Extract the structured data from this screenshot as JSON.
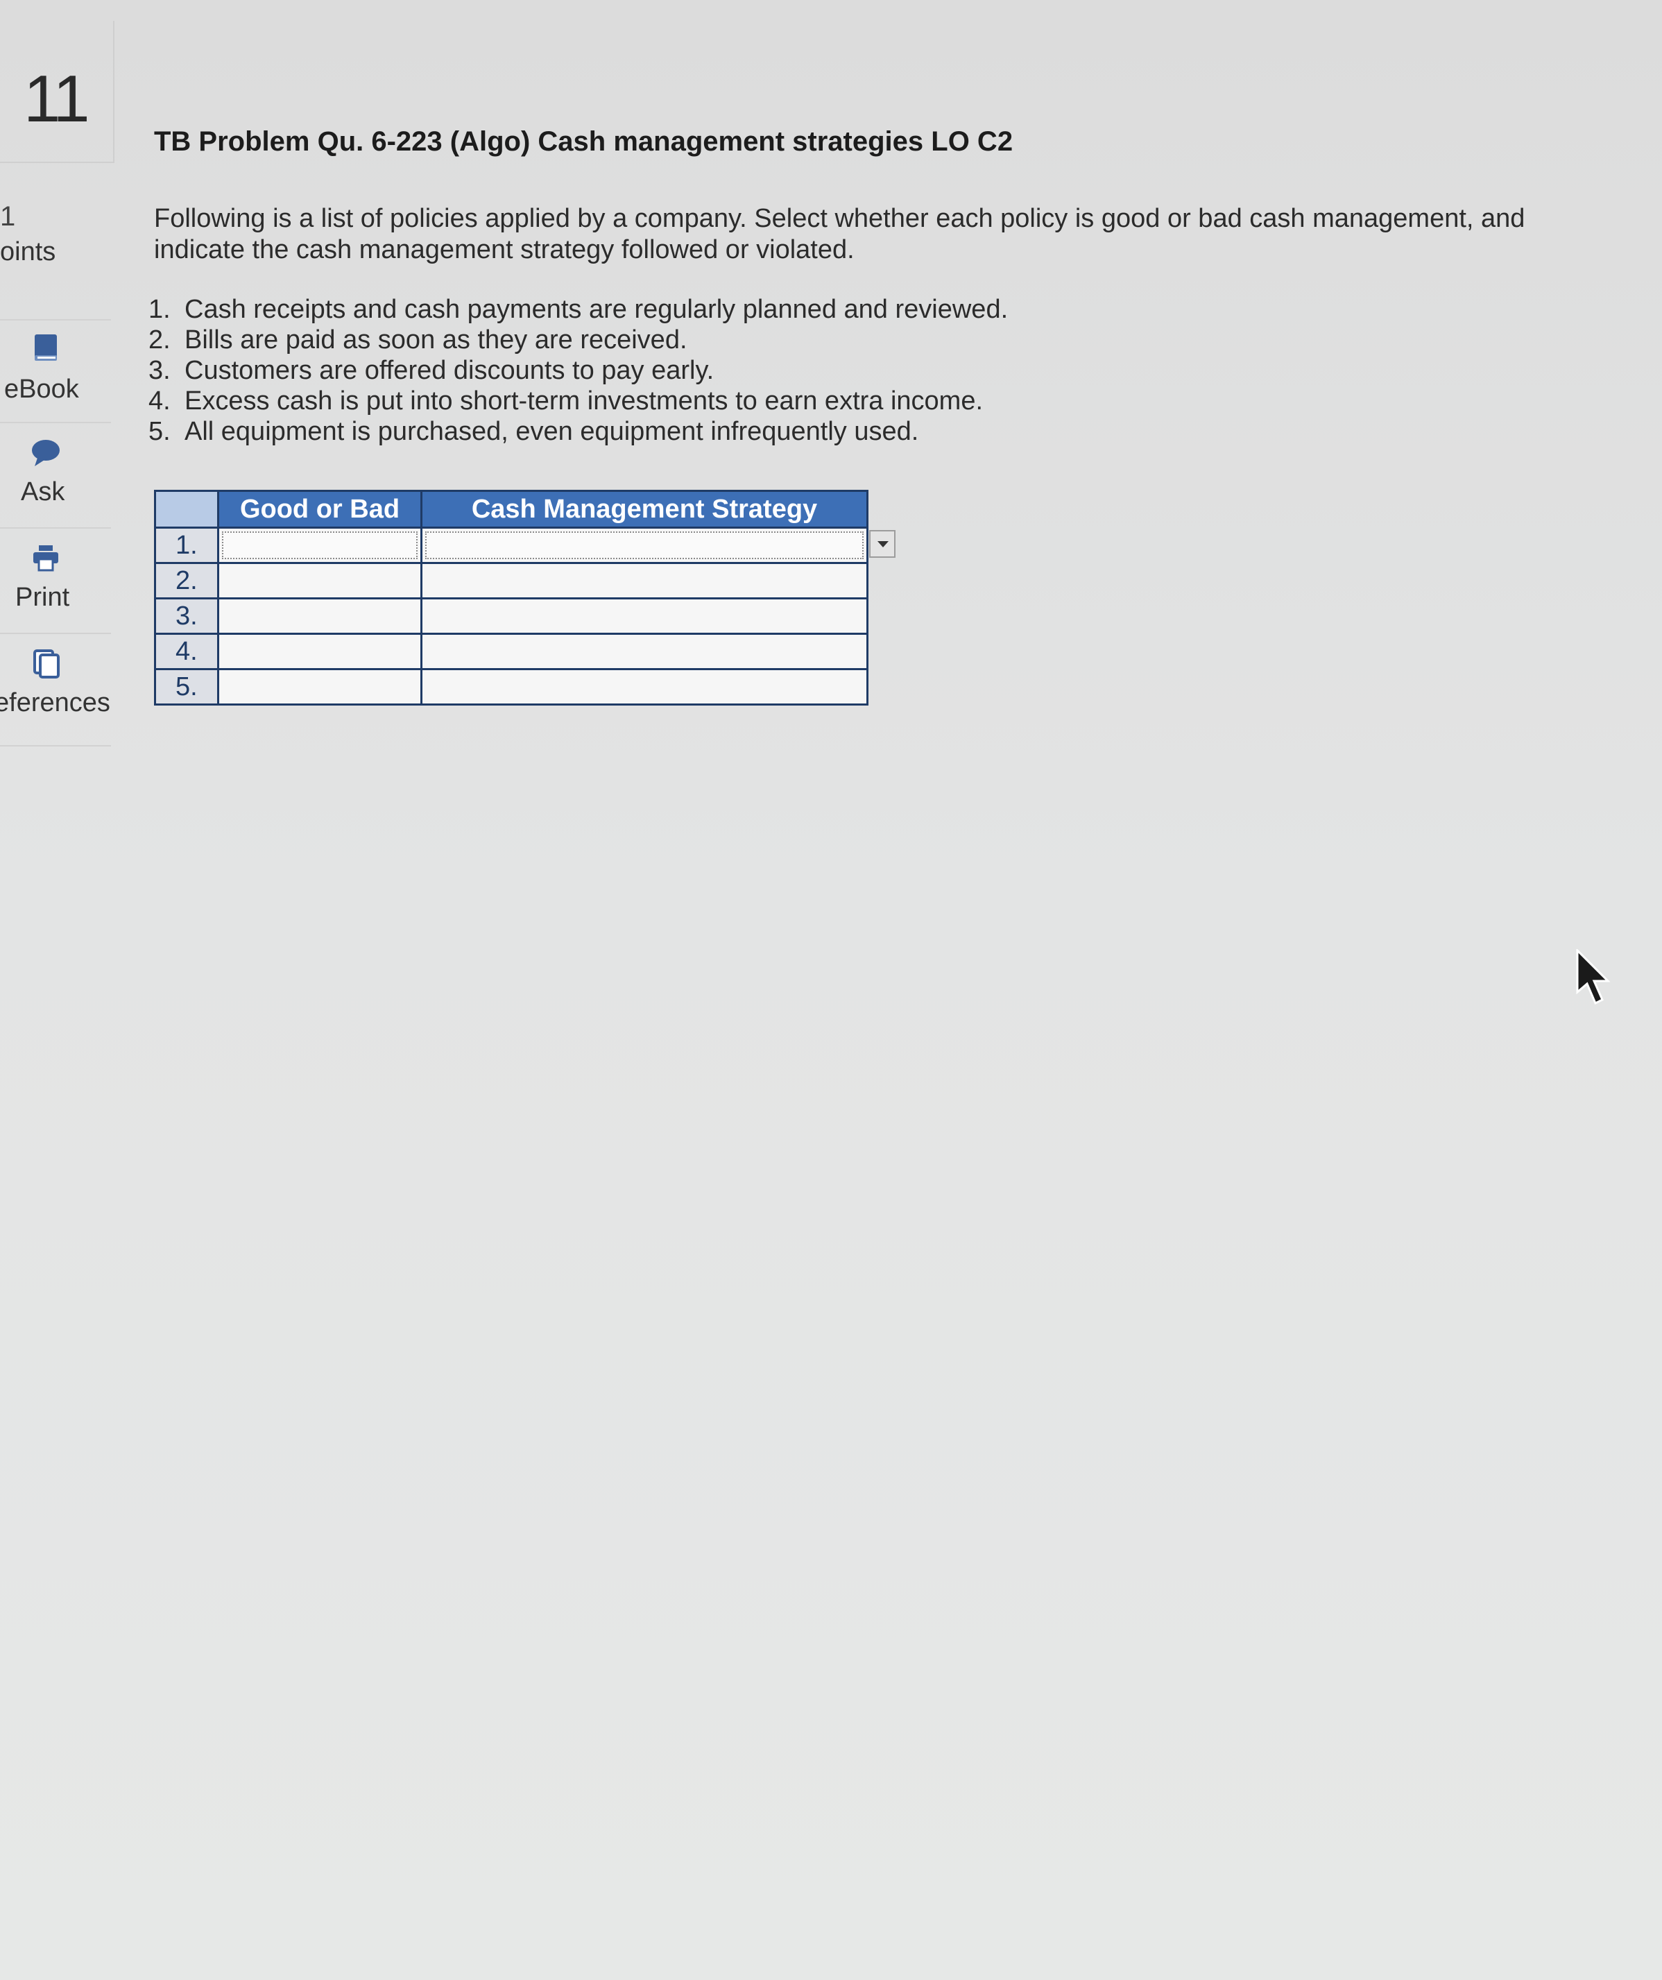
{
  "sidebar": {
    "question_number": "11",
    "points_value": "1",
    "points_label": "oints",
    "tools": [
      {
        "label": "eBook",
        "icon": "book-icon"
      },
      {
        "label": "Ask",
        "icon": "chat-bubble-icon"
      },
      {
        "label": "Print",
        "icon": "printer-icon"
      },
      {
        "label": "eferences",
        "icon": "references-icon"
      }
    ]
  },
  "problem": {
    "title": "TB Problem Qu. 6-223 (Algo) Cash management strategies LO C2",
    "instructions": "Following is a list of policies applied by a company. Select whether each policy is good or bad cash management, and indicate the cash management strategy followed or violated.",
    "policies": [
      {
        "num": "1.",
        "text": "Cash receipts and cash payments are regularly planned and reviewed."
      },
      {
        "num": "2.",
        "text": "Bills are paid as soon as they are received."
      },
      {
        "num": "3.",
        "text": "Customers are offered discounts to pay early."
      },
      {
        "num": "4.",
        "text": "Excess cash is put into short-term investments to earn extra income."
      },
      {
        "num": "5.",
        "text": "All equipment is purchased, even equipment infrequently used."
      }
    ]
  },
  "answer_grid": {
    "headers": [
      "",
      "Good or Bad",
      "Cash Management Strategy"
    ],
    "rows": [
      {
        "num": "1.",
        "good_or_bad": "",
        "strategy": ""
      },
      {
        "num": "2.",
        "good_or_bad": "",
        "strategy": ""
      },
      {
        "num": "3.",
        "good_or_bad": "",
        "strategy": ""
      },
      {
        "num": "4.",
        "good_or_bad": "",
        "strategy": ""
      },
      {
        "num": "5.",
        "good_or_bad": "",
        "strategy": ""
      }
    ]
  },
  "colors": {
    "header_blue": "#3d6fb6",
    "grid_border": "#1f3b66",
    "tool_icon": "#3a5f9a"
  }
}
